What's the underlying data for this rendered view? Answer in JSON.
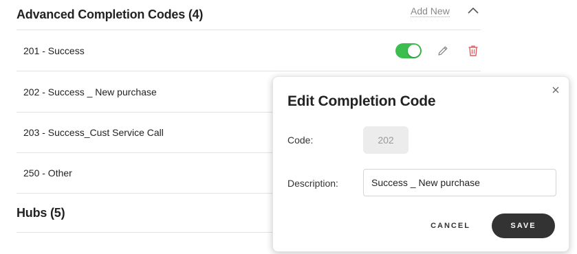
{
  "advanced_section": {
    "title": "Advanced Completion Codes (4)",
    "add_new_label": "Add New",
    "collapse_icon": "chevron-up-icon",
    "codes": [
      {
        "label": "201 - Success",
        "enabled": true
      },
      {
        "label": "202 - Success _ New purchase"
      },
      {
        "label": "203 - Success_Cust Service Call"
      },
      {
        "label": "250 - Other"
      }
    ],
    "row_icons": [
      "toggle-switch",
      "pencil-icon",
      "trash-icon"
    ]
  },
  "hubs_section": {
    "title": "Hubs (5)"
  },
  "modal": {
    "title": "Edit Completion Code",
    "code_label": "Code:",
    "code_value": "202",
    "description_label": "Description:",
    "description_value": "Success _ New purchase",
    "cancel_label": "CANCEL",
    "save_label": "SAVE",
    "close_icon": "close-icon"
  },
  "colors": {
    "toggle_on": "#3cbe4e",
    "delete_red": "#e05a5a",
    "save_button_bg": "#333333",
    "divider": "#e2e2e2"
  }
}
